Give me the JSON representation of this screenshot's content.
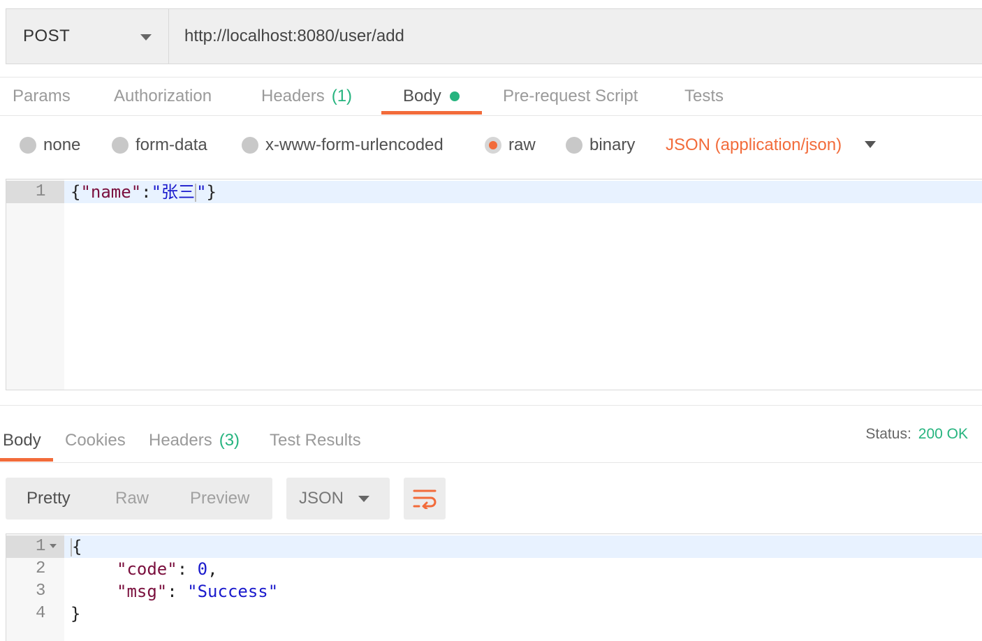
{
  "request": {
    "method": "POST",
    "url": "http://localhost:8080/user/add"
  },
  "request_tabs": {
    "params": "Params",
    "authorization": "Authorization",
    "headers": "Headers",
    "headers_count": "(1)",
    "body": "Body",
    "prerequest": "Pre-request Script",
    "tests": "Tests"
  },
  "body_types": {
    "none": "none",
    "form_data": "form-data",
    "urlencoded": "x-www-form-urlencoded",
    "raw": "raw",
    "binary": "binary",
    "selected": "raw",
    "content_type": "JSON (application/json)"
  },
  "request_editor": {
    "line_numbers": [
      "1"
    ],
    "line1": {
      "open": "{",
      "key": "\"name\"",
      "colon": ":",
      "value_open": "\"张三",
      "value_close": "\"",
      "close": "}"
    }
  },
  "response_tabs": {
    "body": "Body",
    "cookies": "Cookies",
    "headers": "Headers",
    "headers_count": "(3)",
    "test_results": "Test Results"
  },
  "status": {
    "label": "Status:",
    "value": "200 OK"
  },
  "view_modes": {
    "pretty": "Pretty",
    "raw": "Raw",
    "preview": "Preview",
    "format": "JSON"
  },
  "response_editor": {
    "line_numbers": [
      "1",
      "2",
      "3",
      "4"
    ],
    "open": "{",
    "code_key": "\"code\"",
    "code_colon": ": ",
    "code_value": "0",
    "code_comma": ",",
    "msg_key": "\"msg\"",
    "msg_colon": ": ",
    "msg_value": "\"Success\"",
    "close": "}"
  },
  "colors": {
    "accent": "#f26b3a",
    "success": "#26b47f"
  }
}
